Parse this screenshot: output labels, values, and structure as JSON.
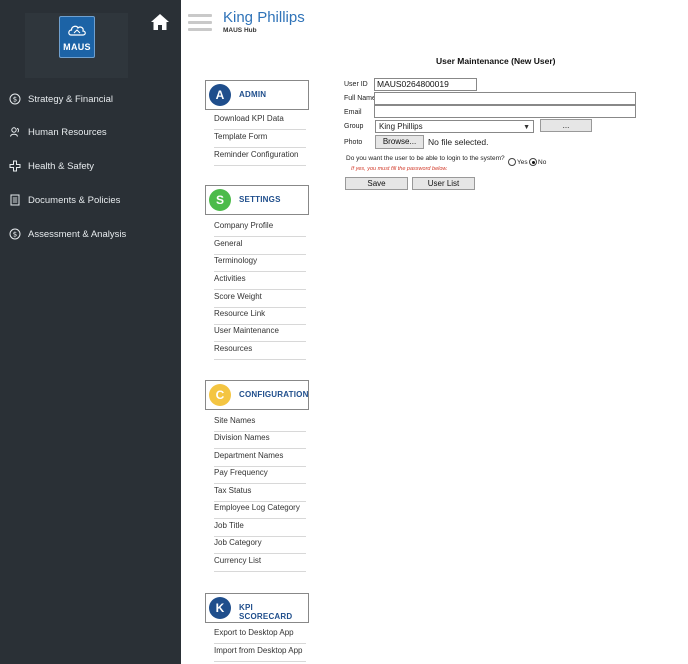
{
  "sidebar": {
    "logo_text": "MAUS",
    "items": [
      {
        "label": "Strategy & Financial",
        "icon": "dollar-circle-icon"
      },
      {
        "label": "Human Resources",
        "icon": "people-icon"
      },
      {
        "label": "Health & Safety",
        "icon": "medical-cross-icon"
      },
      {
        "label": "Documents & Policies",
        "icon": "document-icon"
      },
      {
        "label": "Assessment & Analysis",
        "icon": "dollar-circle-icon"
      }
    ]
  },
  "header": {
    "company": "King Phillips",
    "subtitle": "MAUS Hub"
  },
  "menu": {
    "admin": {
      "letter": "A",
      "title": "ADMIN",
      "color": "#1f4e8c",
      "items": [
        "Download KPI Data",
        "Template Form",
        "Reminder Configuration"
      ]
    },
    "settings": {
      "letter": "S",
      "title": "SETTINGS",
      "color": "#4cbb4a",
      "items": [
        "Company Profile",
        "General",
        "Terminology",
        "Activities",
        "Score Weight",
        "Resource Link",
        "User Maintenance",
        "Resources"
      ]
    },
    "configuration": {
      "letter": "C",
      "title": "CONFIGURATION",
      "color": "#f4c542",
      "items": [
        "Site Names",
        "Division Names",
        "Department Names",
        "Pay Frequency",
        "Tax Status",
        "Employee Log Category",
        "Job Title",
        "Job Category",
        "Currency List"
      ]
    },
    "kpi": {
      "letter": "K",
      "title": "KPI SCORECARD",
      "color": "#1f4e8c",
      "items": [
        "Export to Desktop App",
        "Import from Desktop App"
      ]
    }
  },
  "form": {
    "title": "User Maintenance (New User)",
    "user_id_label": "User ID",
    "user_id_value": "MAUS0264800019",
    "full_name_label": "Full Name",
    "full_name_value": "",
    "email_label": "Email",
    "email_value": "",
    "group_label": "Group",
    "group_value": "King Phillips",
    "group_more_button": "...",
    "photo_label": "Photo",
    "browse_button": "Browse...",
    "file_status": "No file selected.",
    "login_question": "Do you want the user to be able to login to the system?",
    "yes_label": "Yes",
    "no_label": "No",
    "login_selected": "No",
    "warning": "If yes, you must fill the password below.",
    "save_button": "Save",
    "user_list_button": "User List"
  }
}
